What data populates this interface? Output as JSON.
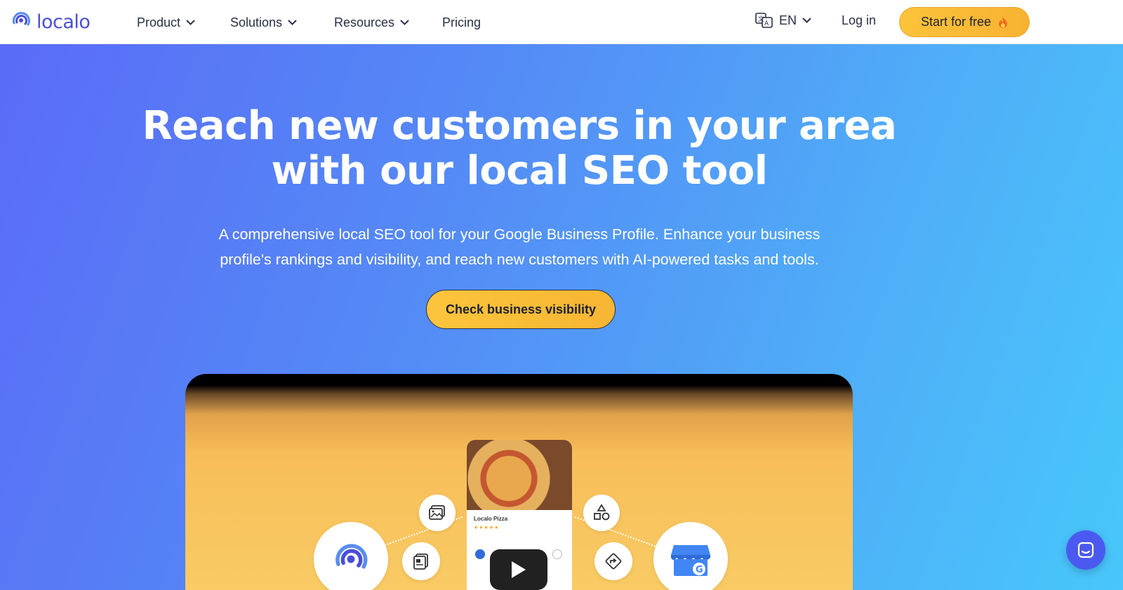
{
  "brand": {
    "name": "localo",
    "accent": "#4a4fd8"
  },
  "nav": {
    "items": [
      {
        "label": "Product",
        "has_dropdown": true
      },
      {
        "label": "Solutions",
        "has_dropdown": true
      },
      {
        "label": "Resources",
        "has_dropdown": true
      },
      {
        "label": "Pricing",
        "has_dropdown": false
      }
    ],
    "language": "EN",
    "login": "Log in",
    "cta": "Start for free"
  },
  "hero": {
    "title_line1": "Reach new customers in your area",
    "title_line2": "with our local SEO tool",
    "subtitle_line1": "A comprehensive local SEO tool for your Google Business Profile. Enhance your business",
    "subtitle_line2": "profile's rankings and visibility, and reach new customers with AI-powered tasks and tools.",
    "cta": "Check business visibility"
  },
  "video": {
    "business_name": "Localo Pizza",
    "rating_stars": "★★★★★"
  },
  "colors": {
    "cta_yellow": "#fcc33a",
    "hero_gradient_start": "#5a6bf7",
    "hero_gradient_end": "#47c7fb"
  }
}
